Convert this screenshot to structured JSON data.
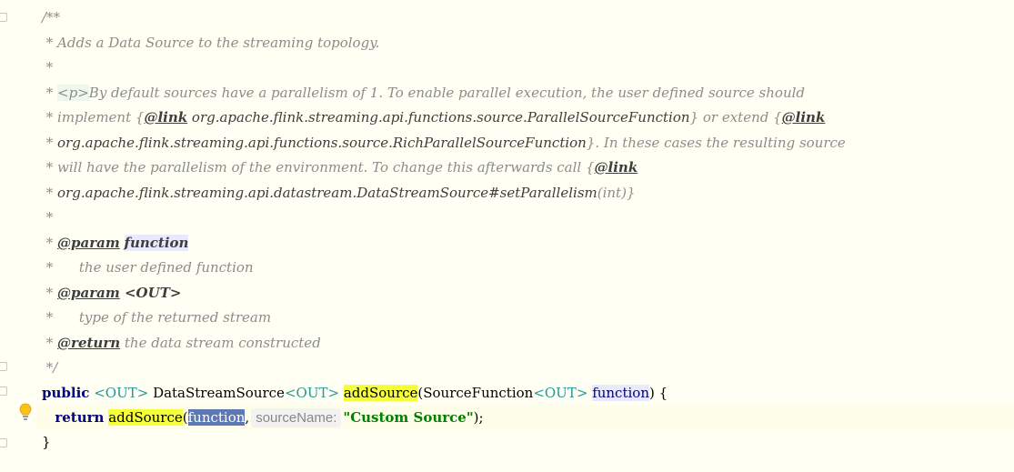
{
  "editor": {
    "lines": {
      "l1": "/**",
      "l2": " * Adds a Data Source to the streaming topology.",
      "l3": " *",
      "l4_prefix": " * ",
      "l4_tag": "<p>",
      "l4_rest": "By default sources have a parallelism of 1. To enable parallel execution, the user defined source should",
      "l5_prefix": " * implement {",
      "l5_link": "@link",
      "l5_ref": " org.apache.flink.streaming.api.functions.source.ParallelSourceFunction",
      "l5_rest": "} or extend {",
      "l5_link2": "@link",
      "l6_prefix": " * ",
      "l6_ref": "org.apache.flink.streaming.api.functions.source.RichParallelSourceFunction",
      "l6_rest": "}. In these cases the resulting source",
      "l7_prefix": " * will have the parallelism of the environment. To change this afterwards call {",
      "l7_link": "@link",
      "l8_prefix": " * ",
      "l8_ref": "org.apache.flink.streaming.api.datastream.DataStreamSource#setParallelism",
      "l8_rest": "(int)}",
      "l9": " *",
      "l10_prefix": " * ",
      "l10_tag": "@param",
      "l10_sp": " ",
      "l10_name": "function",
      "l11": " *      the user defined function",
      "l12_prefix": " * ",
      "l12_tag": "@param",
      "l12_name": " <OUT>",
      "l13": " *      type of the returned stream",
      "l14_prefix": " * ",
      "l14_tag": "@return",
      "l14_rest": " the data stream constructed",
      "l15": " */",
      "l16_kw": "public",
      "l16_sp": " ",
      "l16_tp1": "<OUT>",
      "l16_type": " DataStreamSource",
      "l16_tp2": "<OUT>",
      "l16_sp2": " ",
      "l16_method": "addSource",
      "l16_paren": "(SourceFunction",
      "l16_tp3": "<OUT>",
      "l16_sp3": " ",
      "l16_param": "function",
      "l16_end": ") {",
      "l17_indent": "   ",
      "l17_kw": "return",
      "l17_sp": " ",
      "l17_method": "addSource",
      "l17_paren": "(",
      "l17_arg": "function",
      "l17_comma": ",",
      "l17_hint": "sourceName:",
      "l17_str": "\"Custom Source\"",
      "l17_end": ");",
      "l18": "}"
    }
  }
}
